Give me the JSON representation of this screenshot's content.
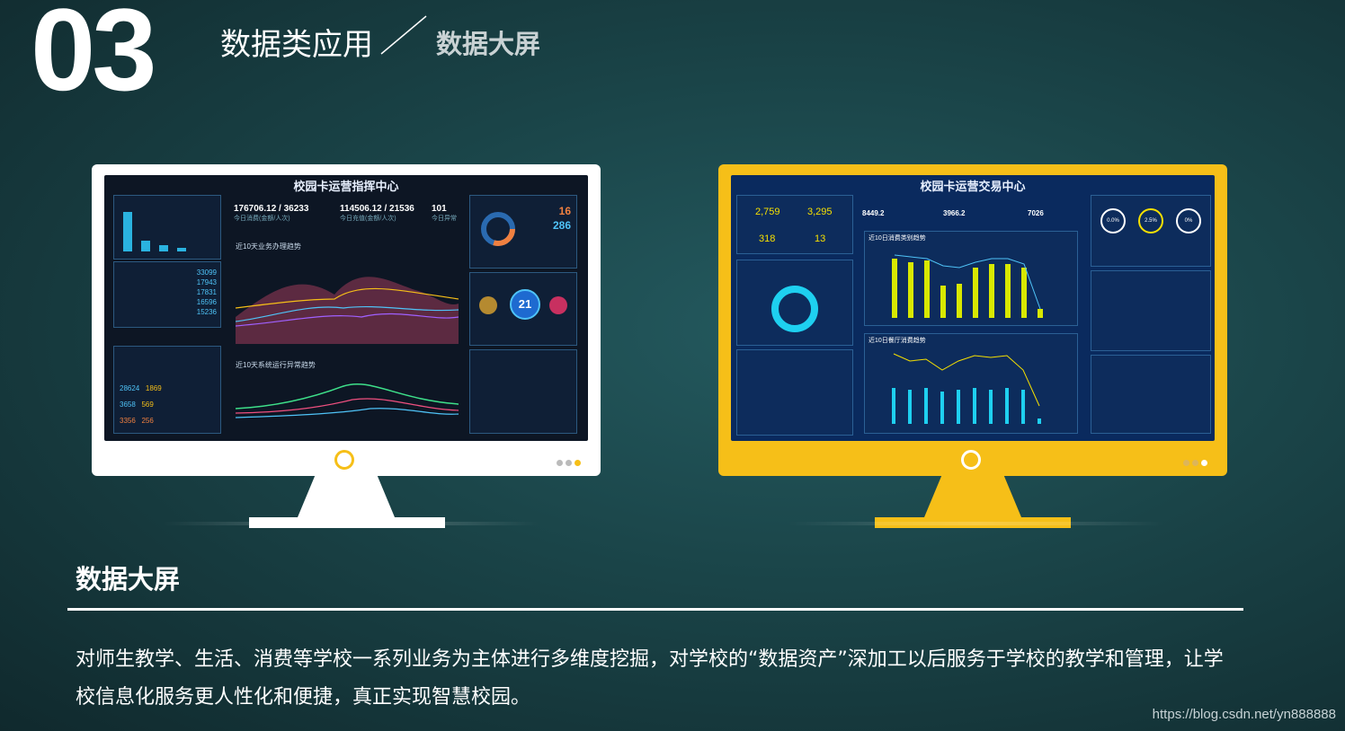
{
  "header": {
    "number": "03",
    "title": "数据类应用",
    "subtitle": "数据大屏"
  },
  "monitor1": {
    "title": "校园卡运营指挥中心",
    "stats": [
      {
        "value": "176706.12 / 36233",
        "label": "今日消费(金额/人次)"
      },
      {
        "value": "114506.12 / 21536",
        "label": "今日充值(金额/人次)"
      },
      {
        "value": "101",
        "label": "今日异常"
      }
    ],
    "chart1_title": "近10天业务办理趋势",
    "chart2_title": "近10天系统运行异常趋势",
    "left_values": [
      "33099",
      "17943",
      "17831",
      "16596",
      "15236"
    ],
    "count_rows": [
      {
        "a": "28624",
        "b": "1869"
      },
      {
        "a": "3658",
        "b": "569"
      },
      {
        "a": "3356",
        "b": "256"
      }
    ],
    "gauge": {
      "a": "16",
      "b": "286"
    },
    "bubble": "21"
  },
  "monitor2": {
    "title": "校园卡运营交易中心",
    "stats": [
      "2,759",
      "3,295",
      "318",
      "13"
    ],
    "mini": [
      "8449.2",
      "3966.2",
      "7026"
    ],
    "chart1_title": "近10日消费类别趋势",
    "chart2_title": "近10日餐厅消费趋势",
    "rings": [
      "0.0%",
      "2.5%",
      "0%"
    ]
  },
  "section": {
    "title": "数据大屏",
    "desc": "对师生教学、生活、消费等学校一系列业务为主体进行多维度挖掘，对学校的“数据资产”深加工以后服务于学校的教学和管理，让学校信息化服务更人性化和便捷，真正实现智慧校园。"
  },
  "watermark": "https://blog.csdn.net/yn888888",
  "colors": {
    "accent": "#f6bf18",
    "screen_dark": "#0d1624",
    "screen_blue": "#0a2a5e"
  }
}
